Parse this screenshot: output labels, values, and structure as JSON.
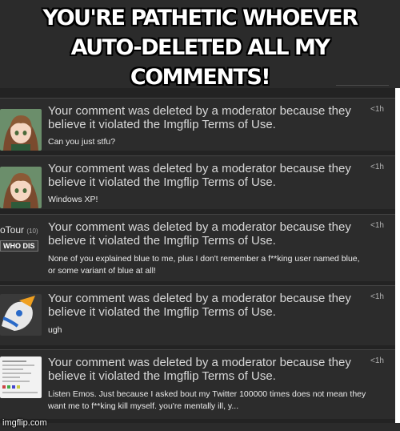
{
  "caption": "YOU'RE PATHETIC WHOEVER\nAUTO-DELETED ALL MY COMMENTS!",
  "watermark": "imgflip.com",
  "colors": {
    "panel_bg": "#232323",
    "row_bg": "#2c2c2c",
    "text": "#d8d8d8"
  },
  "notifications": [
    {
      "avatar": "anime-girl-avatar",
      "message": "Your comment was deleted by a moderator because they believe it violated the Imgflip Terms of Use.",
      "time": "<1h",
      "comment": "Can you just stfu?"
    },
    {
      "avatar": "anime-girl-avatar",
      "message": "Your comment was deleted by a moderator because they believe it violated the Imgflip Terms of Use.",
      "time": "<1h",
      "comment": "Windows XP!"
    },
    {
      "avatar": "otour-thumbnail",
      "avatar_label": "oTour",
      "avatar_sub": "(10)",
      "avatar_badge": "WHO DIS",
      "message": "Your comment was deleted by a moderator because they believe it violated the Imgflip Terms of Use.",
      "time": "<1h",
      "comment": "None of you explained blue to me, plus I don't remember a f**king user named blue, or some variant of blue at all!"
    },
    {
      "avatar": "cartoon-character-avatar",
      "message": "Your comment was deleted by a moderator because they believe it violated the Imgflip Terms of Use.",
      "time": "<1h",
      "comment": "ugh"
    },
    {
      "avatar": "screenshot-thumbnail",
      "message": "Your comment was deleted by a moderator because they believe it violated the Imgflip Terms of Use.",
      "time": "<1h",
      "comment": "Listen Emos. Just because I asked bout my Twitter 100000 times does not mean they want me to f**king kill myself. you're mentally ill, y..."
    }
  ]
}
